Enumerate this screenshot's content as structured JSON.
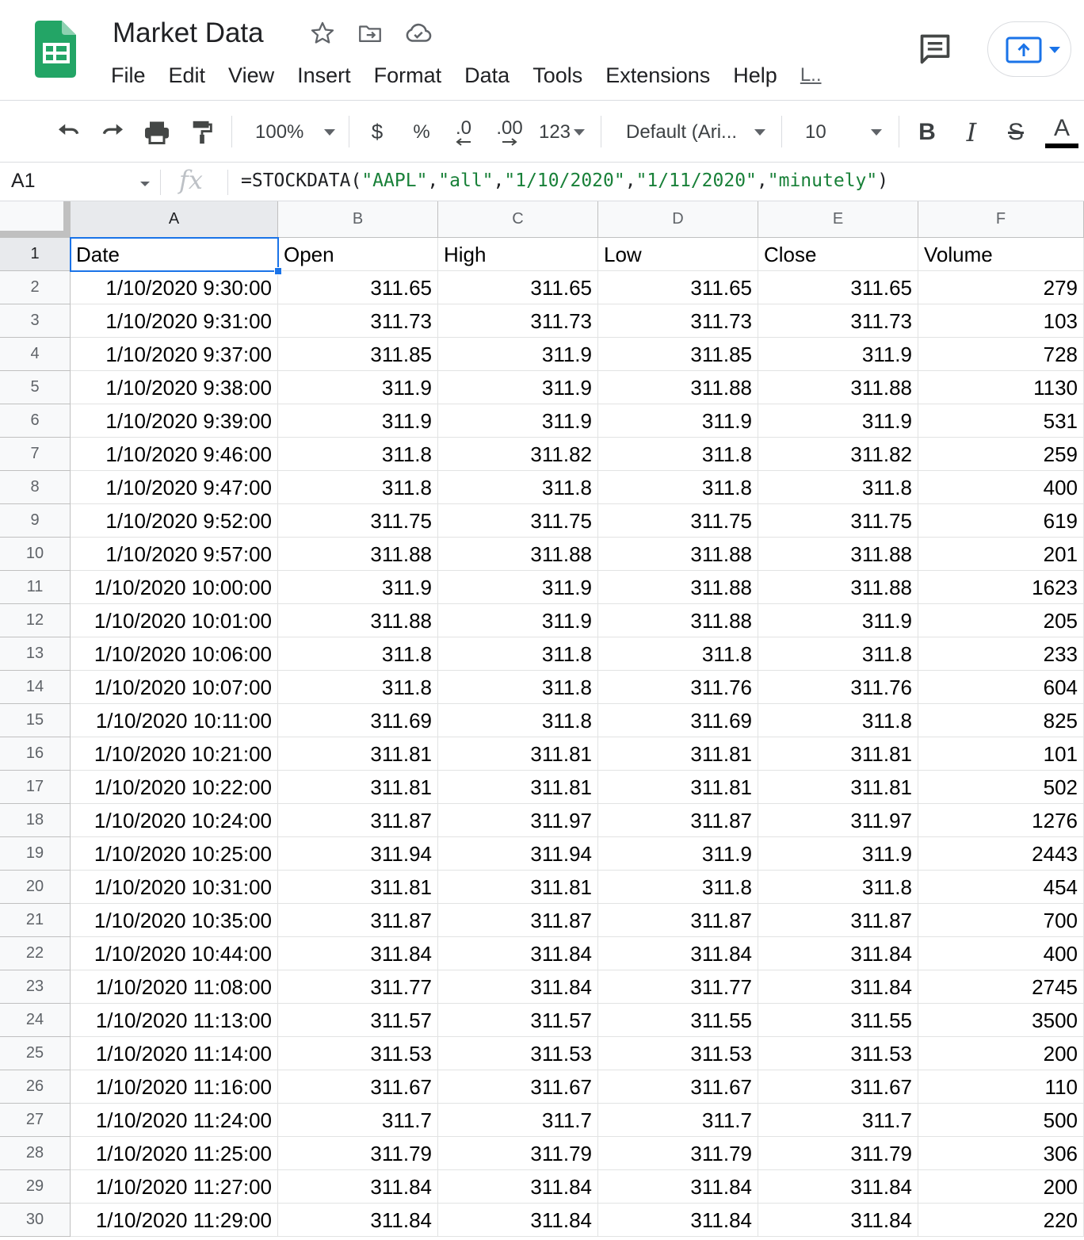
{
  "doc": {
    "title": "Market Data",
    "menus": [
      "File",
      "Edit",
      "View",
      "Insert",
      "Format",
      "Data",
      "Tools",
      "Extensions",
      "Help",
      "L.."
    ]
  },
  "toolbar": {
    "zoom": "100%",
    "currency": "$",
    "percent": "%",
    "decrease_decimals": ".0",
    "increase_decimals": ".00",
    "more_formats": "123",
    "font": "Default (Ari...",
    "font_size": "10",
    "bold": "B",
    "italic": "I",
    "strikethrough": "S",
    "text_color": "A"
  },
  "formula_bar": {
    "cell_ref": "A1",
    "fx": "fx",
    "formula_parts": [
      {
        "t": "=STOCKDATA(",
        "s": false
      },
      {
        "t": "\"AAPL\"",
        "s": true
      },
      {
        "t": ",",
        "s": false
      },
      {
        "t": "\"all\"",
        "s": true
      },
      {
        "t": ",",
        "s": false
      },
      {
        "t": "\"1/10/2020\"",
        "s": true
      },
      {
        "t": ",",
        "s": false
      },
      {
        "t": "\"1/11/2020\"",
        "s": true
      },
      {
        "t": ",",
        "s": false
      },
      {
        "t": "\"minutely\"",
        "s": true
      },
      {
        "t": ")",
        "s": false
      }
    ]
  },
  "sheet": {
    "columns": [
      "A",
      "B",
      "C",
      "D",
      "E",
      "F"
    ],
    "header_row": [
      "Date",
      "Open",
      "High",
      "Low",
      "Close",
      "Volume"
    ],
    "rows": [
      [
        "1/10/2020 9:30:00",
        "311.65",
        "311.65",
        "311.65",
        "311.65",
        "279"
      ],
      [
        "1/10/2020 9:31:00",
        "311.73",
        "311.73",
        "311.73",
        "311.73",
        "103"
      ],
      [
        "1/10/2020 9:37:00",
        "311.85",
        "311.9",
        "311.85",
        "311.9",
        "728"
      ],
      [
        "1/10/2020 9:38:00",
        "311.9",
        "311.9",
        "311.88",
        "311.88",
        "1130"
      ],
      [
        "1/10/2020 9:39:00",
        "311.9",
        "311.9",
        "311.9",
        "311.9",
        "531"
      ],
      [
        "1/10/2020 9:46:00",
        "311.8",
        "311.82",
        "311.8",
        "311.82",
        "259"
      ],
      [
        "1/10/2020 9:47:00",
        "311.8",
        "311.8",
        "311.8",
        "311.8",
        "400"
      ],
      [
        "1/10/2020 9:52:00",
        "311.75",
        "311.75",
        "311.75",
        "311.75",
        "619"
      ],
      [
        "1/10/2020 9:57:00",
        "311.88",
        "311.88",
        "311.88",
        "311.88",
        "201"
      ],
      [
        "1/10/2020 10:00:00",
        "311.9",
        "311.9",
        "311.88",
        "311.88",
        "1623"
      ],
      [
        "1/10/2020 10:01:00",
        "311.88",
        "311.9",
        "311.88",
        "311.9",
        "205"
      ],
      [
        "1/10/2020 10:06:00",
        "311.8",
        "311.8",
        "311.8",
        "311.8",
        "233"
      ],
      [
        "1/10/2020 10:07:00",
        "311.8",
        "311.8",
        "311.76",
        "311.76",
        "604"
      ],
      [
        "1/10/2020 10:11:00",
        "311.69",
        "311.8",
        "311.69",
        "311.8",
        "825"
      ],
      [
        "1/10/2020 10:21:00",
        "311.81",
        "311.81",
        "311.81",
        "311.81",
        "101"
      ],
      [
        "1/10/2020 10:22:00",
        "311.81",
        "311.81",
        "311.81",
        "311.81",
        "502"
      ],
      [
        "1/10/2020 10:24:00",
        "311.87",
        "311.97",
        "311.87",
        "311.97",
        "1276"
      ],
      [
        "1/10/2020 10:25:00",
        "311.94",
        "311.94",
        "311.9",
        "311.9",
        "2443"
      ],
      [
        "1/10/2020 10:31:00",
        "311.81",
        "311.81",
        "311.8",
        "311.8",
        "454"
      ],
      [
        "1/10/2020 10:35:00",
        "311.87",
        "311.87",
        "311.87",
        "311.87",
        "700"
      ],
      [
        "1/10/2020 10:44:00",
        "311.84",
        "311.84",
        "311.84",
        "311.84",
        "400"
      ],
      [
        "1/10/2020 11:08:00",
        "311.77",
        "311.84",
        "311.77",
        "311.84",
        "2745"
      ],
      [
        "1/10/2020 11:13:00",
        "311.57",
        "311.57",
        "311.55",
        "311.55",
        "3500"
      ],
      [
        "1/10/2020 11:14:00",
        "311.53",
        "311.53",
        "311.53",
        "311.53",
        "200"
      ],
      [
        "1/10/2020 11:16:00",
        "311.67",
        "311.67",
        "311.67",
        "311.67",
        "110"
      ],
      [
        "1/10/2020 11:24:00",
        "311.7",
        "311.7",
        "311.7",
        "311.7",
        "500"
      ],
      [
        "1/10/2020 11:25:00",
        "311.79",
        "311.79",
        "311.79",
        "311.79",
        "306"
      ],
      [
        "1/10/2020 11:27:00",
        "311.84",
        "311.84",
        "311.84",
        "311.84",
        "200"
      ],
      [
        "1/10/2020 11:29:00",
        "311.84",
        "311.84",
        "311.84",
        "311.84",
        "220"
      ]
    ]
  },
  "colors": {
    "accent": "#1a73e8",
    "sheets_green": "#0f9d58",
    "formula_string": "#188038"
  }
}
